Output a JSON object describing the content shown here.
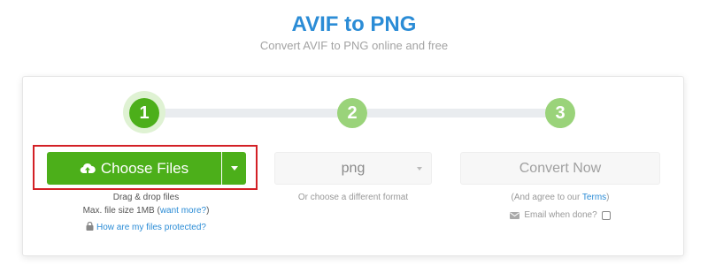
{
  "header": {
    "title": "AVIF to PNG",
    "subtitle": "Convert AVIF to PNG online and free"
  },
  "steps": [
    {
      "number": "1",
      "state": "active"
    },
    {
      "number": "2",
      "state": "inactive"
    },
    {
      "number": "3",
      "state": "inactive"
    }
  ],
  "upload": {
    "choose_label": "Choose Files",
    "icon": "cloud-upload-icon",
    "drag_text": "Drag & drop files",
    "max_size_prefix": "Max. file size 1MB (",
    "want_more_link": "want more?",
    "max_size_suffix": ")",
    "protected_link": "How are my files protected?"
  },
  "format": {
    "selected": "png",
    "hint": "Or choose a different format"
  },
  "convert": {
    "button_label": "Convert Now",
    "agree_prefix": "(And agree to our ",
    "terms_link": "Terms",
    "agree_suffix": ")",
    "email_label": "Email when done?"
  },
  "colors": {
    "title_blue": "#2b8cd6",
    "primary_green": "#4caf1a",
    "step_inactive_green": "#9ad37a",
    "highlight_red": "#d32026"
  }
}
